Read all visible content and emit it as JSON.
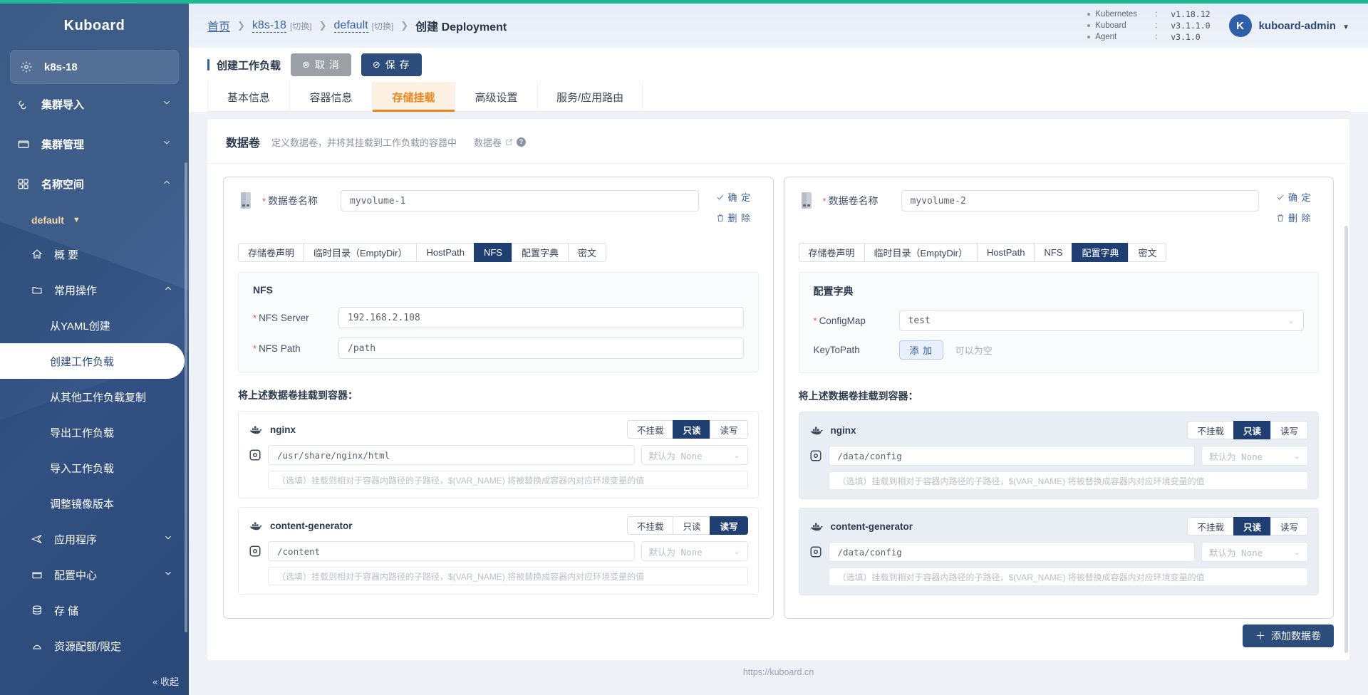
{
  "brand": {
    "title": "Kuboard"
  },
  "sidebar": {
    "cluster": {
      "label": "k8s-18",
      "icon": "gear-icon"
    },
    "groups": [
      {
        "label": "集群导入",
        "icon": "import-icon",
        "chevron": "down"
      },
      {
        "label": "集群管理",
        "icon": "box-icon",
        "chevron": "down"
      },
      {
        "label": "名称空间",
        "icon": "grid-icon",
        "chevron": "up"
      }
    ],
    "namespace": {
      "label": "default",
      "caret": "▼"
    },
    "overview": {
      "label": "概 要",
      "icon": "home-icon"
    },
    "common_ops": {
      "label": "常用操作",
      "icon": "folder-icon",
      "chevron": "up"
    },
    "ops_items": [
      {
        "label": "从YAML创建",
        "selected": false
      },
      {
        "label": "创建工作负载",
        "selected": true
      },
      {
        "label": "从其他工作负载复制",
        "selected": false
      },
      {
        "label": "导出工作负载",
        "selected": false
      },
      {
        "label": "导入工作负载",
        "selected": false
      },
      {
        "label": "调整镜像版本",
        "selected": false
      }
    ],
    "tail_groups": [
      {
        "label": "应用程序",
        "icon": "send-icon",
        "chevron": "down"
      },
      {
        "label": "配置中心",
        "icon": "box-icon",
        "chevron": "down"
      },
      {
        "label": "存 储",
        "icon": "database-icon",
        "chevron": ""
      },
      {
        "label": "资源配额/限定",
        "icon": "dome-icon",
        "chevron": ""
      }
    ],
    "collapse": "« 收起"
  },
  "header": {
    "breadcrumb": {
      "home": "首页",
      "cluster": "k8s-18",
      "cluster_switch": "[切换]",
      "namespace": "default",
      "namespace_switch": "[切换]",
      "current": "创建 Deployment"
    },
    "versions": [
      {
        "key": "Kubernetes",
        "sep": ":",
        "value": "v1.18.12"
      },
      {
        "key": "Kuboard",
        "sep": ":",
        "value": "v3.1.1.0"
      },
      {
        "key": "Agent",
        "sep": ":",
        "value": "v3.1.0"
      }
    ],
    "user": {
      "initial": "K",
      "name": "kuboard-admin",
      "caret": "▼"
    }
  },
  "actionbar": {
    "page_title": "创建工作负载",
    "cancel": {
      "label": "取 消",
      "glyph": "⊗"
    },
    "save": {
      "label": "保 存",
      "glyph": "⊘"
    }
  },
  "tabs": [
    {
      "label": "基本信息",
      "active": false
    },
    {
      "label": "容器信息",
      "active": false
    },
    {
      "label": "存储挂载",
      "active": true
    },
    {
      "label": "高级设置",
      "active": false
    },
    {
      "label": "服务/应用路由",
      "active": false
    }
  ],
  "panel": {
    "title": "数据卷",
    "description": "定义数据卷，并将其挂载到工作负载的容器中",
    "doc_link": "数据卷"
  },
  "common": {
    "volume_name_label": "数据卷名称",
    "confirm": "确 定",
    "delete": "删 除",
    "type_tabs": [
      "存储卷声明",
      "临时目录（EmptyDir）",
      "HostPath",
      "NFS",
      "配置字典",
      "密文"
    ],
    "mount_title": "将上述数据卷挂载到容器：",
    "modes": [
      "不挂载",
      "只读",
      "读写"
    ],
    "none_placeholder": "默认为 None",
    "subpath_placeholder": "（选填）挂载到相对于容器内路径的子路径，$(VAR_NAME) 将被替换成容器内对应环境变量的值"
  },
  "volumes": [
    {
      "name": "myvolume-1",
      "active_type": "NFS",
      "section_title": "NFS",
      "fields": [
        {
          "label": "NFS Server",
          "required": true,
          "value": "192.168.2.108"
        },
        {
          "label": "NFS Path",
          "required": true,
          "value": "/path"
        }
      ],
      "containers": [
        {
          "name": "nginx",
          "path": "/usr/share/nginx/html",
          "mode": "只读",
          "style": "plain"
        },
        {
          "name": "content-generator",
          "path": "/content",
          "mode": "读写",
          "style": "plain"
        }
      ]
    },
    {
      "name": "myvolume-2",
      "active_type": "配置字典",
      "section_title": "配置字典",
      "configmap": {
        "label": "ConfigMap",
        "required": true,
        "value": "test"
      },
      "keytopath": {
        "label": "KeyToPath",
        "button": "添 加",
        "hint": "可以为空"
      },
      "containers": [
        {
          "name": "nginx",
          "path": "/data/config",
          "mode": "只读",
          "style": "tinted"
        },
        {
          "name": "content-generator",
          "path": "/data/config",
          "mode": "只读",
          "style": "tinted"
        }
      ]
    }
  ],
  "add_volume": {
    "label": "添加数据卷",
    "glyph": "＋"
  },
  "footer": {
    "text": "https://kuboard.cn"
  },
  "colors": {
    "accent_orange": "#f08519",
    "primary_blue": "#2c4c7c",
    "sidebar_blue": "#2d4f80",
    "top_strip_green": "#20b894",
    "selected_tab_bg": "#1f3f73"
  }
}
